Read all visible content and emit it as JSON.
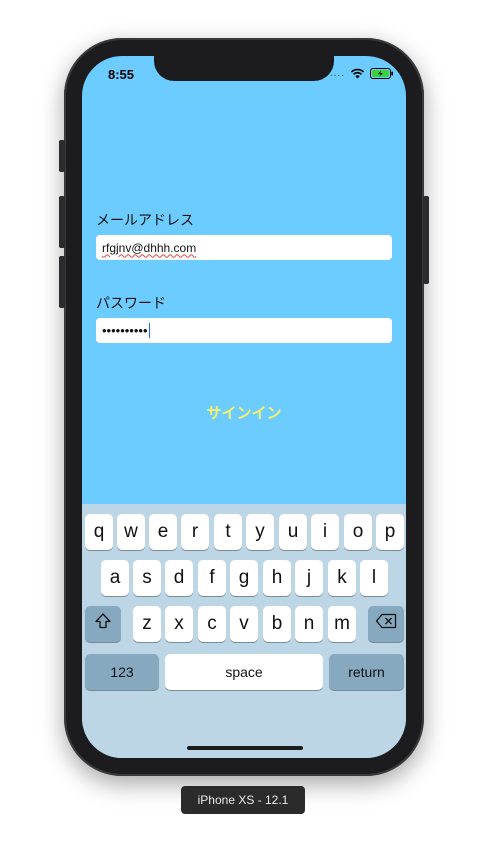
{
  "status_bar": {
    "time": "8:55",
    "signal_dots": "....",
    "wifi_icon": "wifi-icon",
    "battery_icon": "battery-icon"
  },
  "form": {
    "email_label": "メールアドレス",
    "email_value": "rfgjnv@dhhh.com",
    "password_label": "パスワード",
    "password_value": "••••••••••",
    "signin_label": "サインイン"
  },
  "keyboard": {
    "row1": [
      "q",
      "w",
      "e",
      "r",
      "t",
      "y",
      "u",
      "i",
      "o",
      "p"
    ],
    "row2": [
      "a",
      "s",
      "d",
      "f",
      "g",
      "h",
      "j",
      "k",
      "l"
    ],
    "row3": [
      "z",
      "x",
      "c",
      "v",
      "b",
      "n",
      "m"
    ],
    "numbers_label": "123",
    "space_label": "space",
    "return_label": "return",
    "shift_icon": "shift-icon",
    "delete_icon": "delete-icon"
  },
  "device_label": "iPhone XS - 12.1",
  "colors": {
    "screen_bg": "#6ccbff",
    "signin_text": "#f7f36a",
    "keyboard_bg": "#bcd6e6"
  }
}
